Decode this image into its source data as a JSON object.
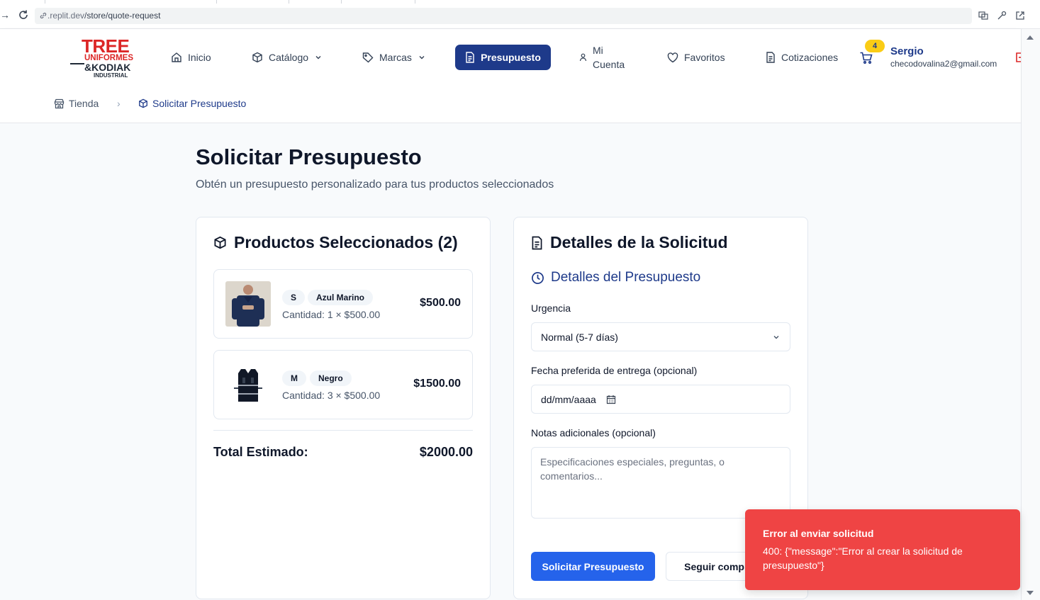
{
  "browser": {
    "url_prefix": ".replit.dev",
    "url_path": "/store/quote-request"
  },
  "header": {
    "logo": {
      "line1": "TREE",
      "line2": "UNIFORMES",
      "line3": "&KODIAK",
      "line4": "INDUSTRIAL"
    },
    "nav": {
      "inicio": "Inicio",
      "catalogo": "Catálogo",
      "marcas": "Marcas",
      "presupuesto": "Presupuesto",
      "mi_cuenta_1": "Mi",
      "mi_cuenta_2": "Cuenta",
      "favoritos": "Favoritos",
      "cotizaciones": "Cotizaciones"
    },
    "cart_count": "4",
    "user": {
      "name": "Sergio",
      "email": "checodovalina2@gmail.com"
    }
  },
  "breadcrumb": {
    "home": "Tienda",
    "current": "Solicitar Presupuesto"
  },
  "page": {
    "title": "Solicitar Presupuesto",
    "subtitle": "Obtén un presupuesto personalizado para tus productos seleccionados"
  },
  "products_card": {
    "title": "Productos Seleccionados (2)",
    "items": [
      {
        "size": "S",
        "color": "Azul Marino",
        "qty": "Cantidad: 1 × $500.00",
        "price": "$500.00"
      },
      {
        "size": "M",
        "color": "Negro",
        "qty": "Cantidad: 3 × $500.00",
        "price": "$1500.00"
      }
    ],
    "total_label": "Total Estimado:",
    "total_value": "$2000.00"
  },
  "details_card": {
    "title": "Detalles de la Solicitud",
    "section_title": "Detalles del Presupuesto",
    "urgency_label": "Urgencia",
    "urgency_value": "Normal (5-7 días)",
    "date_label": "Fecha preferida de entrega (opcional)",
    "date_placeholder": "dd/mm/aaaa",
    "notes_label": "Notas adicionales (opcional)",
    "notes_placeholder": "Especificaciones especiales, preguntas, o comentarios...",
    "submit_label": "Solicitar Presupuesto",
    "continue_label": "Seguir comprando"
  },
  "toast": {
    "title": "Error al enviar solicitud",
    "message": "400: {\"message\":\"Error al crear la solicitud de presupuesto\"}"
  },
  "colors": {
    "brand_navy": "#1e3a8a",
    "brand_red": "#dc2626",
    "primary_blue": "#2563eb",
    "toast_red": "#ef4444",
    "badge_yellow": "#facc15"
  }
}
